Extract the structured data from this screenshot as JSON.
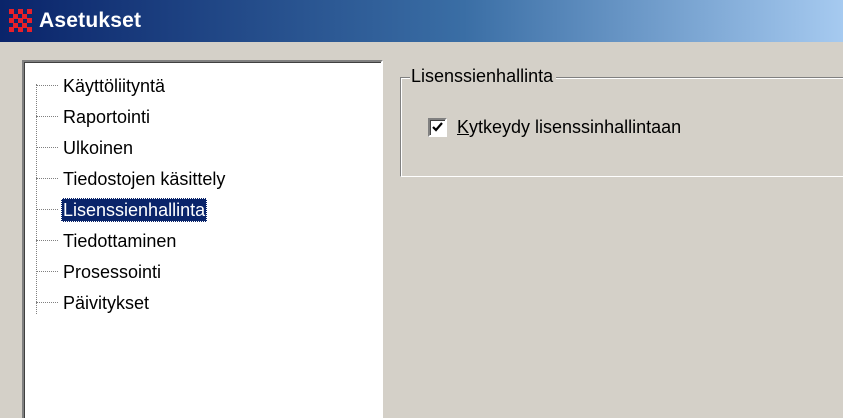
{
  "window": {
    "title": "Asetukset",
    "icon": "app-grid-icon",
    "accent_color": "#0a246a",
    "selection_color": "#0a246a"
  },
  "tree": {
    "items": [
      {
        "label": "Käyttöliityntä",
        "selected": false
      },
      {
        "label": "Raportointi",
        "selected": false
      },
      {
        "label": "Ulkoinen",
        "selected": false
      },
      {
        "label": "Tiedostojen käsittely",
        "selected": false
      },
      {
        "label": "Lisenssienhallinta",
        "selected": true
      },
      {
        "label": "Tiedottaminen",
        "selected": false
      },
      {
        "label": "Prosessointi",
        "selected": false
      },
      {
        "label": "Päivitykset",
        "selected": false
      }
    ]
  },
  "panel": {
    "group_title": "Lisenssienhallinta",
    "checkbox": {
      "mnemonic": "K",
      "label_rest": "ytkeydy lisenssinhallintaan",
      "checked": true
    }
  }
}
